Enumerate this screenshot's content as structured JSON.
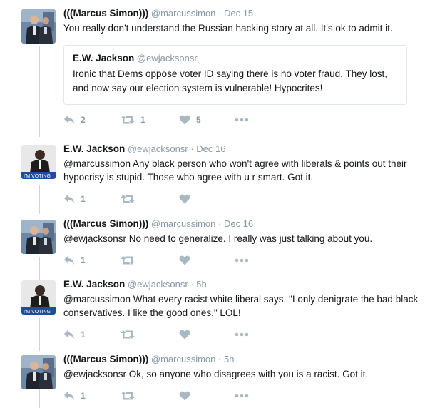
{
  "tweets": [
    {
      "name": "(((Marcus Simon)))",
      "handle": "@marcussimon",
      "time": "Dec 15",
      "text": "You really don't understand the Russian hacking story at all. It's ok to admit it.",
      "avatar": "avatar-marcus",
      "quote": {
        "name": "E.W. Jackson",
        "handle": "@ewjacksonsr",
        "text": "Ironic that Dems oppose voter ID saying there is no voter fraud. They lost, and now say our election system is vulnerable! Hypocrites!"
      },
      "replies": "2",
      "retweets": "1",
      "likes": "5"
    },
    {
      "name": "E.W. Jackson",
      "handle": "@ewjacksonsr",
      "time": "Dec 16",
      "text": "@marcussimon Any black person who won't agree with liberals & points out their hypocrisy is stupid. Those who agree with u r smart. Got it.",
      "avatar": "avatar-jackson",
      "avatar_badge": "I'M VOTING",
      "replies": "1",
      "retweets": "",
      "likes": ""
    },
    {
      "name": "(((Marcus Simon)))",
      "handle": "@marcussimon",
      "time": "Dec 16",
      "text": "@ewjacksonsr No need to generalize. I really was just talking about you.",
      "avatar": "avatar-marcus",
      "replies": "1",
      "retweets": "",
      "likes": ""
    },
    {
      "name": "E.W. Jackson",
      "handle": "@ewjacksonsr",
      "time": "5h",
      "text": "@marcussimon What every racist white liberal says. \"I only denigrate the bad black conservatives. I like the good ones.\" LOL!",
      "avatar": "avatar-jackson",
      "avatar_badge": "I'M VOTING",
      "replies": "1",
      "retweets": "",
      "likes": ""
    },
    {
      "name": "(((Marcus Simon)))",
      "handle": "@marcussimon",
      "time": "5h",
      "text": "@ewjacksonsr Ok, so anyone who disagrees with you is a racist. Got it.",
      "avatar": "avatar-marcus",
      "replies": "1",
      "retweets": "",
      "likes": ""
    }
  ],
  "separator": "·",
  "colors": {
    "text": "#14171a",
    "meta": "#8899a6",
    "thread_line": "#ccd6dd",
    "border": "#e1e8ed"
  }
}
